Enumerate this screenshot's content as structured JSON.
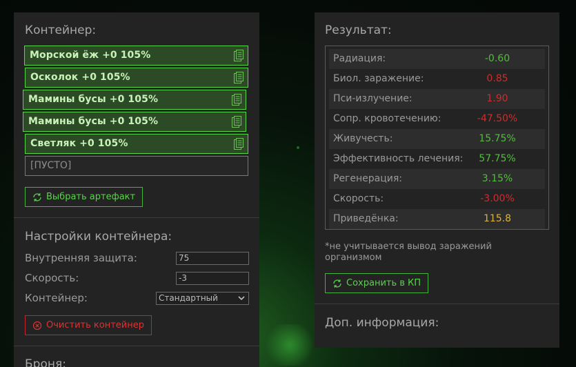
{
  "container": {
    "title": "Контейнер:",
    "slots": [
      {
        "label": "Морской ёж +0 105%"
      },
      {
        "label": "Осколок +0 105%"
      },
      {
        "label": "Мамины бусы +0 105%"
      },
      {
        "label": "Мамины бусы +0 105%"
      },
      {
        "label": "Светляк +0 105%"
      }
    ],
    "empty_slot": "[ПУСТО]",
    "choose_button": "Выбрать артефакт"
  },
  "settings": {
    "title": "Настройки контейнера:",
    "internal_protection_label": "Внутренняя защита:",
    "internal_protection_value": "75",
    "speed_label": "Скорость:",
    "speed_value": "-3",
    "container_label": "Контейнер:",
    "container_value": "Стандартный",
    "clear_button": "Очистить контейнер"
  },
  "armor": {
    "title": "Броня:"
  },
  "result": {
    "title": "Результат:",
    "rows": [
      {
        "name": "Радиация:",
        "value": "-0.60",
        "color": "#52bf3c"
      },
      {
        "name": "Биол. заражение:",
        "value": "0.85",
        "color": "#d22b2b"
      },
      {
        "name": "Пси-излучение:",
        "value": "1.90",
        "color": "#d22b2b"
      },
      {
        "name": "Сопр. кровотечению:",
        "value": "-47.50%",
        "color": "#d22b2b"
      },
      {
        "name": "Живучесть:",
        "value": "15.75%",
        "color": "#52bf3c"
      },
      {
        "name": "Эффективность лечения:",
        "value": "57.75%",
        "color": "#52bf3c"
      },
      {
        "name": "Регенерация:",
        "value": "3.15%",
        "color": "#52bf3c"
      },
      {
        "name": "Скорость:",
        "value": "-3.00%",
        "color": "#d22b2b"
      },
      {
        "name": "Приведёнка:",
        "value": "115.8",
        "color": "#dcb43a"
      }
    ],
    "note": "*не учитывается вывод заражений организмом",
    "save_button": "Сохранить в КП"
  },
  "extra": {
    "title": "Доп. информация:"
  }
}
